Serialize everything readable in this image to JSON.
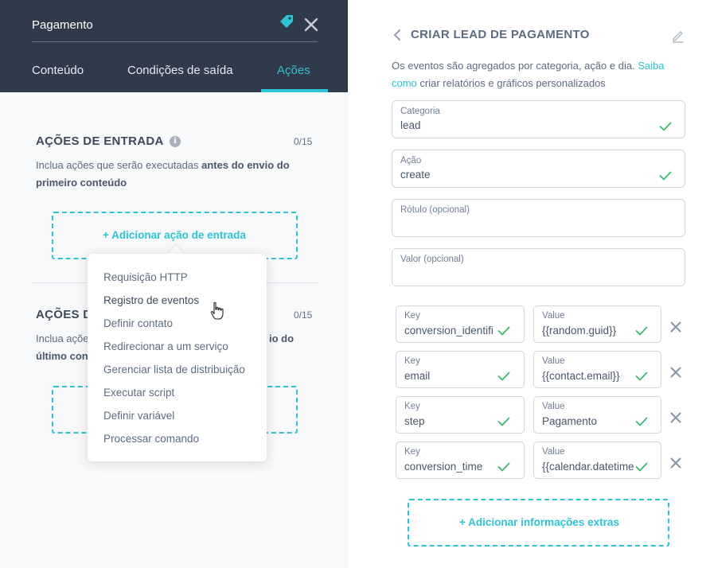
{
  "left_panel": {
    "title": "Pagamento",
    "tabs": [
      "Conteúdo",
      "Condições de saída",
      "Ações"
    ],
    "active_tab": "Ações",
    "entry_section": {
      "title": "AÇÕES DE ENTRADA",
      "counter": "0/15",
      "desc_prefix": "Inclua ações que serão executadas ",
      "desc_bold": "antes do envio do primeiro conteúdo",
      "add_label": "+ Adicionar ação de entrada"
    },
    "exit_section": {
      "title_visible": "AÇÕES D",
      "counter": "0/15",
      "desc_line1": "Inclua açõe",
      "desc_line1_end": "io do",
      "desc_line2": "último con"
    },
    "dropdown": {
      "items": [
        "Requisição HTTP",
        "Registro de eventos",
        "Definir contato",
        "Redirecionar a um serviço",
        "Gerenciar lista de distribuição",
        "Executar script",
        "Definir variável",
        "Processar comando"
      ],
      "hovered_item": "Registro de eventos"
    }
  },
  "right_panel": {
    "title": "CRIAR LEAD DE PAGAMENTO",
    "desc_text": "Os eventos são agregados por categoria, ação e dia. ",
    "desc_link": "Saiba como",
    "desc_rest": " criar relatórios e gráficos personalizados",
    "fields": [
      {
        "label": "Categoria",
        "value": "lead",
        "valid": true
      },
      {
        "label": "Ação",
        "value": "create",
        "valid": true
      },
      {
        "label": "Rótulo (opcional)",
        "value": "",
        "valid": false
      },
      {
        "label": "Valor (opcional)",
        "value": "",
        "valid": false
      }
    ],
    "extras": [
      {
        "key_label": "Key",
        "key": "conversion_identifier",
        "value_label": "Value",
        "value": "{{random.guid}}"
      },
      {
        "key_label": "Key",
        "key": "email",
        "value_label": "Value",
        "value": "{{contact.email}}"
      },
      {
        "key_label": "Key",
        "key": "step",
        "value_label": "Value",
        "value": "Pagamento"
      },
      {
        "key_label": "Key",
        "key": "conversion_time",
        "value_label": "Value",
        "value": "{{calendar.datetime}}"
      }
    ],
    "add_extra_label": "+ Adicionar informações extras"
  },
  "colors": {
    "header_bg": "#2f3a4a",
    "accent": "#2cc3d4",
    "check": "#3dba6f",
    "panel_bg": "#f8f9fa"
  },
  "icons": [
    "tag-icon",
    "close-icon",
    "info-icon",
    "cursor-hand-icon",
    "back-chevron-icon",
    "edit-pencil-icon",
    "check-icon",
    "delete-x-icon"
  ]
}
